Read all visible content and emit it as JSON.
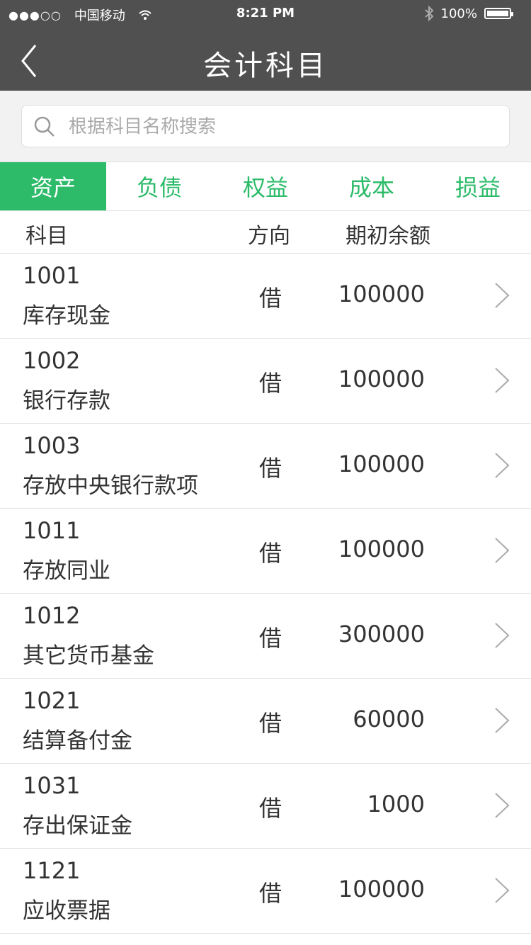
{
  "status_bar": {
    "signal": "●●●○○",
    "carrier": "中国移动",
    "time": "8:21 PM",
    "battery": "100%",
    "icons": [
      "wifi-icon",
      "bluetooth-icon",
      "battery-icon"
    ]
  },
  "nav": {
    "title": "会计科目",
    "back_icon": "back-chevron-icon"
  },
  "search": {
    "placeholder": "根据科目名称搜索",
    "value": ""
  },
  "tabs": [
    {
      "label": "资产",
      "active": true
    },
    {
      "label": "负债",
      "active": false
    },
    {
      "label": "权益",
      "active": false
    },
    {
      "label": "成本",
      "active": false
    },
    {
      "label": "损益",
      "active": false
    }
  ],
  "columns": {
    "subject": "科目",
    "direction": "方向",
    "opening_balance": "期初余额"
  },
  "accounts": [
    {
      "code": "1001",
      "name": "库存现金",
      "direction": "借",
      "amount": "100000"
    },
    {
      "code": "1002",
      "name": "银行存款",
      "direction": "借",
      "amount": "100000"
    },
    {
      "code": "1003",
      "name": "存放中央银行款项",
      "direction": "借",
      "amount": "100000"
    },
    {
      "code": "1011",
      "name": "存放同业",
      "direction": "借",
      "amount": "100000"
    },
    {
      "code": "1012",
      "name": "其它货币基金",
      "direction": "借",
      "amount": "300000"
    },
    {
      "code": "1021",
      "name": "结算备付金",
      "direction": "借",
      "amount": "60000"
    },
    {
      "code": "1031",
      "name": "存出保证金",
      "direction": "借",
      "amount": "1000"
    },
    {
      "code": "1121",
      "name": "应收票据",
      "direction": "借",
      "amount": "100000"
    }
  ],
  "colors": {
    "accent": "#2dbb6a",
    "header": "#505050",
    "search_bg": "#f2f2f2"
  }
}
